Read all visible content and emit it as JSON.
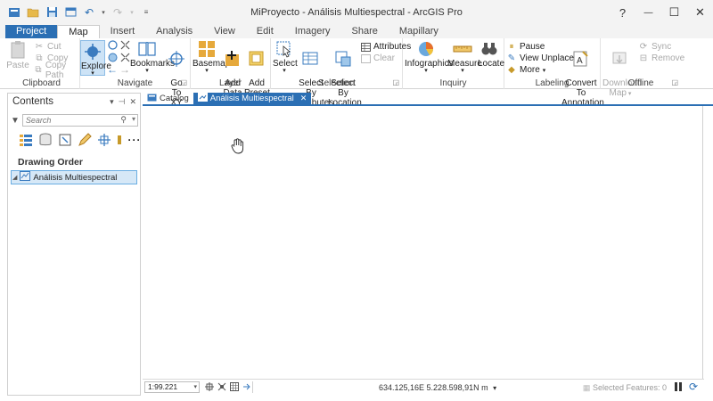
{
  "window": {
    "title": "MiProyecto - Análisis Multiespectral - ArcGIS Pro",
    "help": "?",
    "minimize": "—",
    "maximize": "☐",
    "close": "✕"
  },
  "ribbon_tabs": [
    "Project",
    "Map",
    "Insert",
    "Analysis",
    "View",
    "Edit",
    "Imagery",
    "Share",
    "Mapillary"
  ],
  "active_tab": "Map",
  "clipboard": {
    "label": "Clipboard",
    "paste": "Paste",
    "cut": "Cut",
    "copy": "Copy",
    "copy_path": "Copy Path"
  },
  "navigate": {
    "label": "Navigate",
    "explore": "Explore",
    "bookmarks": "Bookmarks",
    "goto_xy": "Go\nTo XY"
  },
  "layer": {
    "label": "Layer",
    "basemap": "Basemap",
    "add_data": "Add\nData",
    "add_preset": "Add\nPreset"
  },
  "selection": {
    "label": "Selection",
    "select": "Select",
    "select_by_attributes": "Select By\nAttributes",
    "select_by_location": "Select By\nLocation",
    "attributes": "Attributes",
    "clear": "Clear"
  },
  "inquiry": {
    "label": "Inquiry",
    "infographics": "Infographics",
    "measure": "Measure",
    "locate": "Locate"
  },
  "labeling": {
    "label": "Labeling",
    "pause": "Pause",
    "view_unplaced": "View Unplaced",
    "more": "More",
    "convert_to_annotation": "Convert To\nAnnotation"
  },
  "offline": {
    "label": "Offline",
    "download_map": "Download\nMap",
    "sync": "Sync",
    "remove": "Remove"
  },
  "contents": {
    "title": "Contents",
    "search_placeholder": "Search",
    "drawing_order": "Drawing Order",
    "layer_name": "Análisis Multiespectral"
  },
  "doc_tabs": {
    "catalog": "Catalog",
    "map": "Análisis Multiespectral"
  },
  "status": {
    "scale": "1:99.221",
    "coordinates": "634.125,16E 5.228.598,91N m",
    "selected_features": "Selected Features: 0"
  },
  "colors": {
    "accent": "#2b6fb4",
    "selection_fill": "#d6e8f7",
    "selection_border": "#6aaee2"
  }
}
